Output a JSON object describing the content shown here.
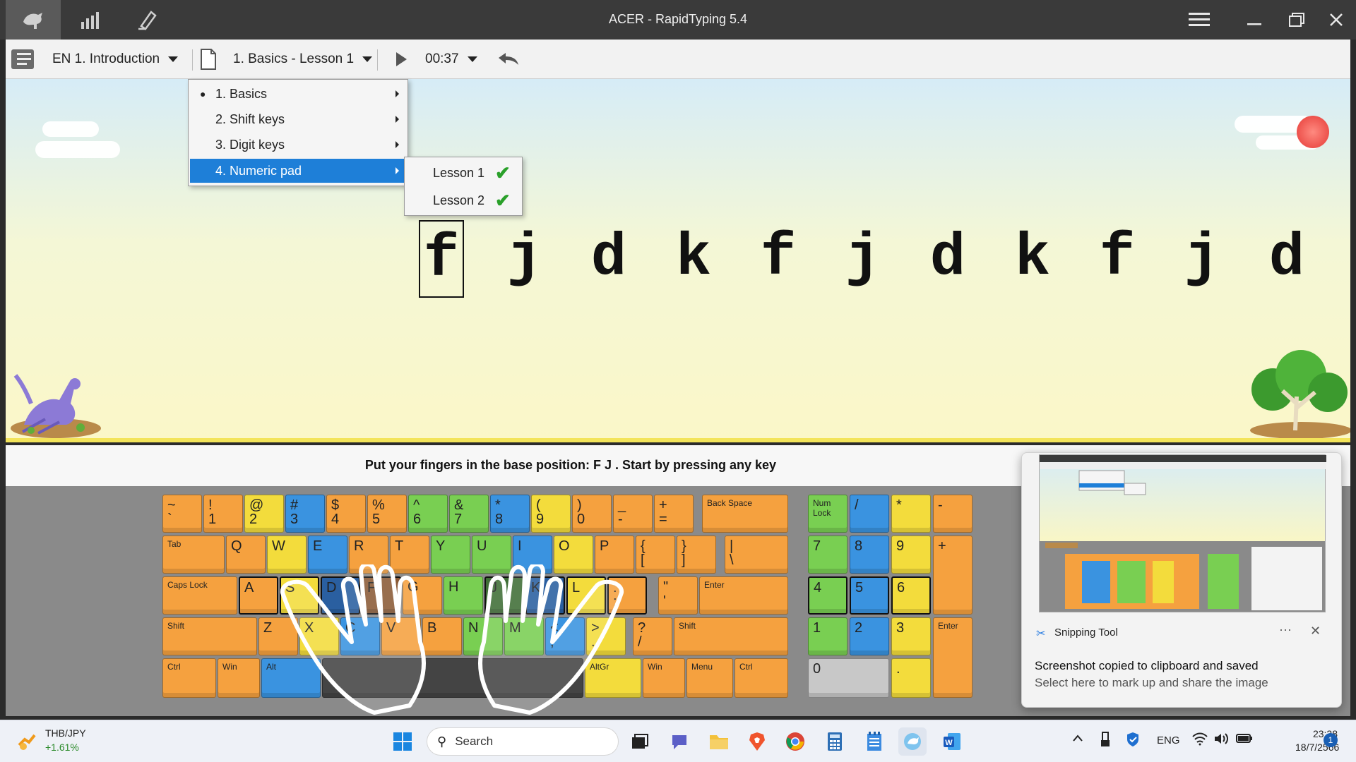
{
  "window": {
    "title": "ACER - RapidTyping 5.4",
    "icons": [
      "typing-mode-icon",
      "statistics-icon",
      "editor-icon"
    ]
  },
  "toolbar": {
    "course": "EN 1. Introduction",
    "lesson": "1. Basics - Lesson 1",
    "timer": "00:37"
  },
  "menu": {
    "items": [
      {
        "label": "1. Basics",
        "bullet": "●"
      },
      {
        "label": "2. Shift keys"
      },
      {
        "label": "3. Digit keys"
      },
      {
        "label": "4. Numeric pad"
      }
    ],
    "submenu": [
      {
        "label": "Lesson 1",
        "done": "✔"
      },
      {
        "label": "Lesson 2",
        "done": "✔"
      }
    ]
  },
  "lesson": {
    "chars": [
      "f",
      "j",
      "d",
      "k",
      "f",
      "j",
      "d",
      "k",
      "f",
      "j",
      "d"
    ],
    "current_index": 0
  },
  "instruction": "Put your fingers in the base position:  F  J .  Start by pressing any key",
  "keyboard": {
    "row1": [
      [
        "~",
        "`"
      ],
      [
        "!",
        "1"
      ],
      [
        "@",
        "2"
      ],
      [
        "#",
        "3"
      ],
      [
        "$",
        "4"
      ],
      [
        "%",
        "5"
      ],
      [
        "^",
        "6"
      ],
      [
        "&",
        "7"
      ],
      [
        "*",
        "8"
      ],
      [
        "(",
        "9"
      ],
      [
        ")",
        "0"
      ],
      [
        "_",
        "-"
      ],
      [
        "+",
        "="
      ],
      [
        "Back Space",
        ""
      ]
    ],
    "row2": [
      "Tab",
      "Q",
      "W",
      "E",
      "R",
      "T",
      "Y",
      "U",
      "I",
      "O",
      "P",
      [
        "{",
        "["
      ],
      [
        "}",
        "]"
      ],
      [
        "|",
        "\\"
      ]
    ],
    "row3": [
      "Caps Lock",
      "A",
      "S",
      "D",
      "F",
      "G",
      "H",
      "J",
      "K",
      "L",
      [
        ":",
        ";"
      ],
      [
        "\"",
        "'"
      ],
      "Enter"
    ],
    "row4": [
      "Shift",
      "Z",
      "X",
      "C",
      "V",
      "B",
      "N",
      "M",
      [
        "<",
        ","
      ],
      [
        ">",
        "."
      ],
      [
        "?",
        "/"
      ],
      "Shift"
    ],
    "row5": [
      "Ctrl",
      "Win",
      "Alt",
      "",
      "AltGr",
      "Win",
      "Menu",
      "Ctrl"
    ],
    "numpad": {
      "num_lock": "Num Lock",
      "divide": "/",
      "multiply": "*",
      "minus": "-",
      "plus": "+",
      "enter": "Enter",
      "digits": [
        "7",
        "8",
        "9",
        "4",
        "5",
        "6",
        "1",
        "2",
        "3",
        "0",
        "."
      ]
    }
  },
  "toast": {
    "app": "Snipping Tool",
    "more": "···",
    "close": "✕",
    "title": "Screenshot copied to clipboard and saved",
    "subtitle": "Select here to mark up and share the image"
  },
  "taskbar": {
    "widget_name": "THB/JPY",
    "widget_change": "+1.61%",
    "search_placeholder": "Search",
    "lang": "ENG",
    "time": "23:38",
    "date": "18/7/2566",
    "notif_count": "1"
  },
  "colors": {
    "orange": "#f5a13f",
    "yellow": "#f3dc3c",
    "blue": "#3a93e0",
    "green": "#79cf52",
    "menu_selected": "#1e7fd8"
  }
}
